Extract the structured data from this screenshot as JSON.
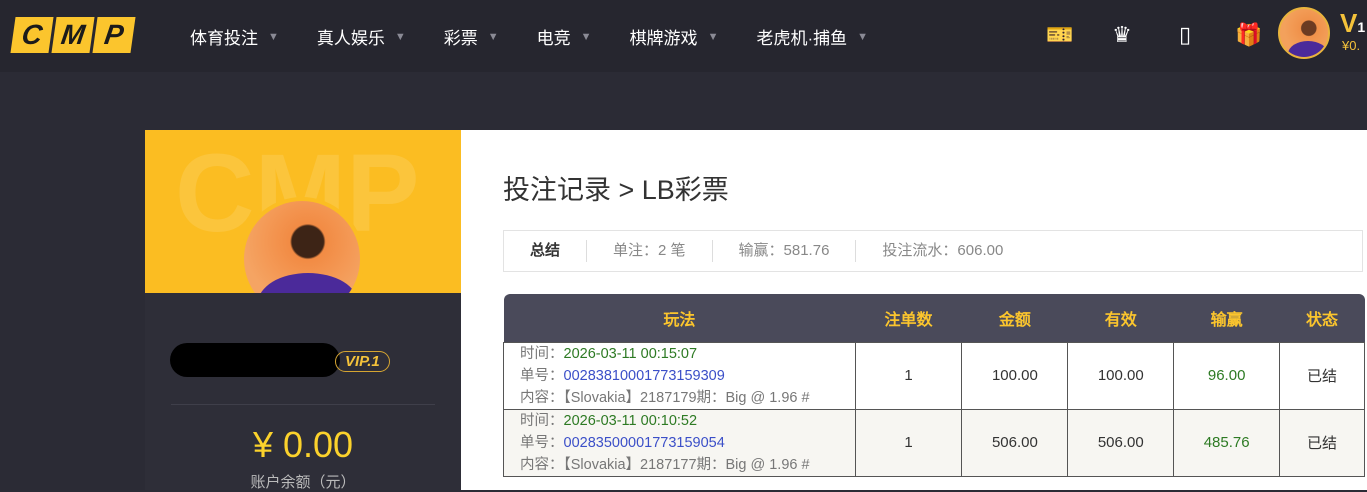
{
  "header": {
    "logo": [
      "C",
      "M",
      "P"
    ],
    "nav": [
      "体育投注",
      "真人娱乐",
      "彩票",
      "电竞",
      "棋牌游戏",
      "老虎机·捕鱼"
    ],
    "icons": [
      "ticket-yen-icon",
      "crown-icon",
      "tablet-icon",
      "gift-icon"
    ],
    "vip": "V",
    "vip_level": "1",
    "balance": "¥0."
  },
  "profile": {
    "watermark": "CMP",
    "vip_badge": "VIP.1",
    "balance": "¥ 0.00",
    "balance_label": "账户余额（元）"
  },
  "main": {
    "title": "投注记录 > LB彩票",
    "summary": {
      "label": "总结",
      "count": "单注：2 笔",
      "win": "输赢：581.76",
      "turnover": "投注流水：606.00"
    },
    "columns": [
      "玩法",
      "注单数",
      "金额",
      "有效",
      "输赢",
      "状态"
    ],
    "rows": [
      {
        "time_label": "时间：",
        "time": "2026-03-11 00:15:07",
        "no_label": "单号：",
        "no": "00283810001773159309",
        "content_label": "内容：",
        "content": "【Slovakia】2187179期：Big @ 1.96 #",
        "count": "1",
        "amount": "100.00",
        "valid": "100.00",
        "win": "96.00",
        "status": "已结"
      },
      {
        "time_label": "时间：",
        "time": "2026-03-11 00:10:52",
        "no_label": "单号：",
        "no": "00283500001773159054",
        "content_label": "内容：",
        "content": "【Slovakia】2187177期：Big @ 1.96 #",
        "count": "1",
        "amount": "506.00",
        "valid": "506.00",
        "win": "485.76",
        "status": "已结"
      }
    ]
  }
}
